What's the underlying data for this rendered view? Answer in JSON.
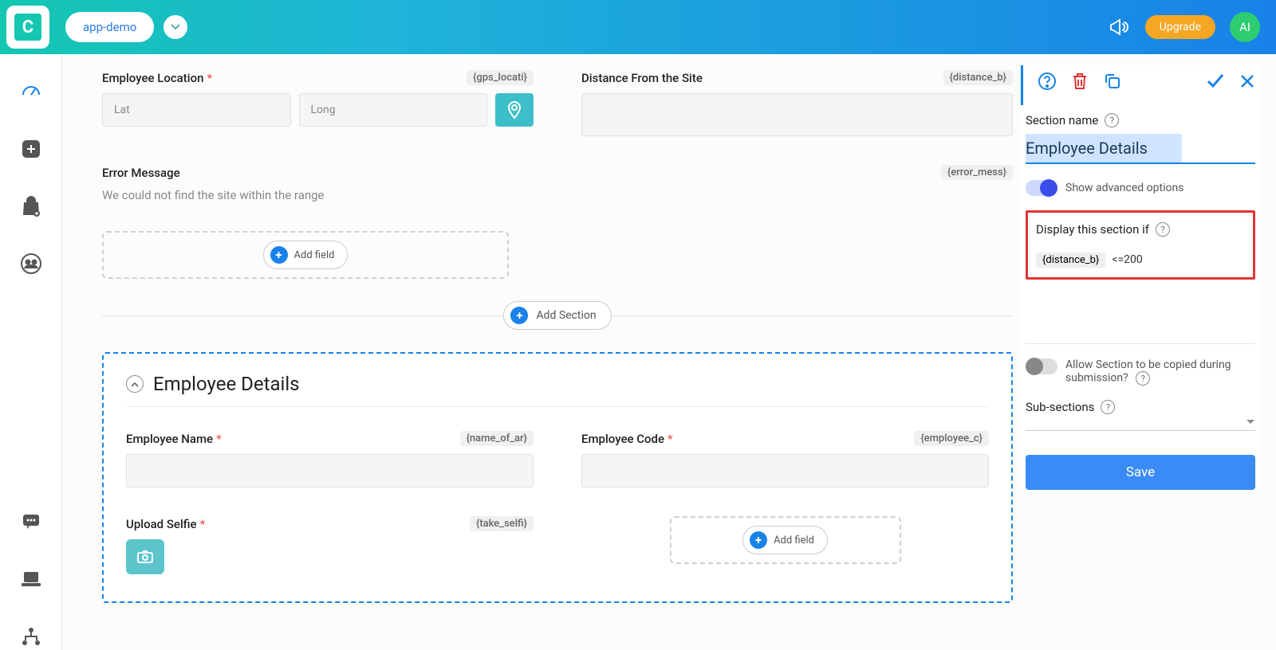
{
  "header": {
    "app_name": "app-demo",
    "upgrade_label": "Upgrade",
    "avatar_initials": "AI"
  },
  "main": {
    "employee_location": {
      "label": "Employee Location",
      "tag": "{gps_locati}",
      "lat_placeholder": "Lat",
      "long_placeholder": "Long"
    },
    "distance_from_site": {
      "label": "Distance From the Site",
      "tag": "{distance_b}"
    },
    "error_message": {
      "label": "Error Message",
      "tag": "{error_mess}",
      "text": "We could not find the site within the range"
    },
    "add_field_label": "Add field",
    "add_section_label": "Add Section"
  },
  "section": {
    "title": "Employee Details",
    "employee_name": {
      "label": "Employee Name",
      "tag": "{name_of_ar}"
    },
    "employee_code": {
      "label": "Employee Code",
      "tag": "{employee_c}"
    },
    "upload_selfie": {
      "label": "Upload Selfie",
      "tag": "{take_selfi}"
    },
    "add_field_label": "Add field"
  },
  "panel": {
    "section_name_label": "Section name",
    "section_name_value": "Employee Details",
    "advanced_label": "Show advanced options",
    "display_if_label": "Display this section if",
    "condition_var": "{distance_b}",
    "condition_expr": "<=200",
    "allow_copy_label": "Allow Section to be copied during submission?",
    "sub_sections_label": "Sub-sections",
    "save_label": "Save"
  }
}
